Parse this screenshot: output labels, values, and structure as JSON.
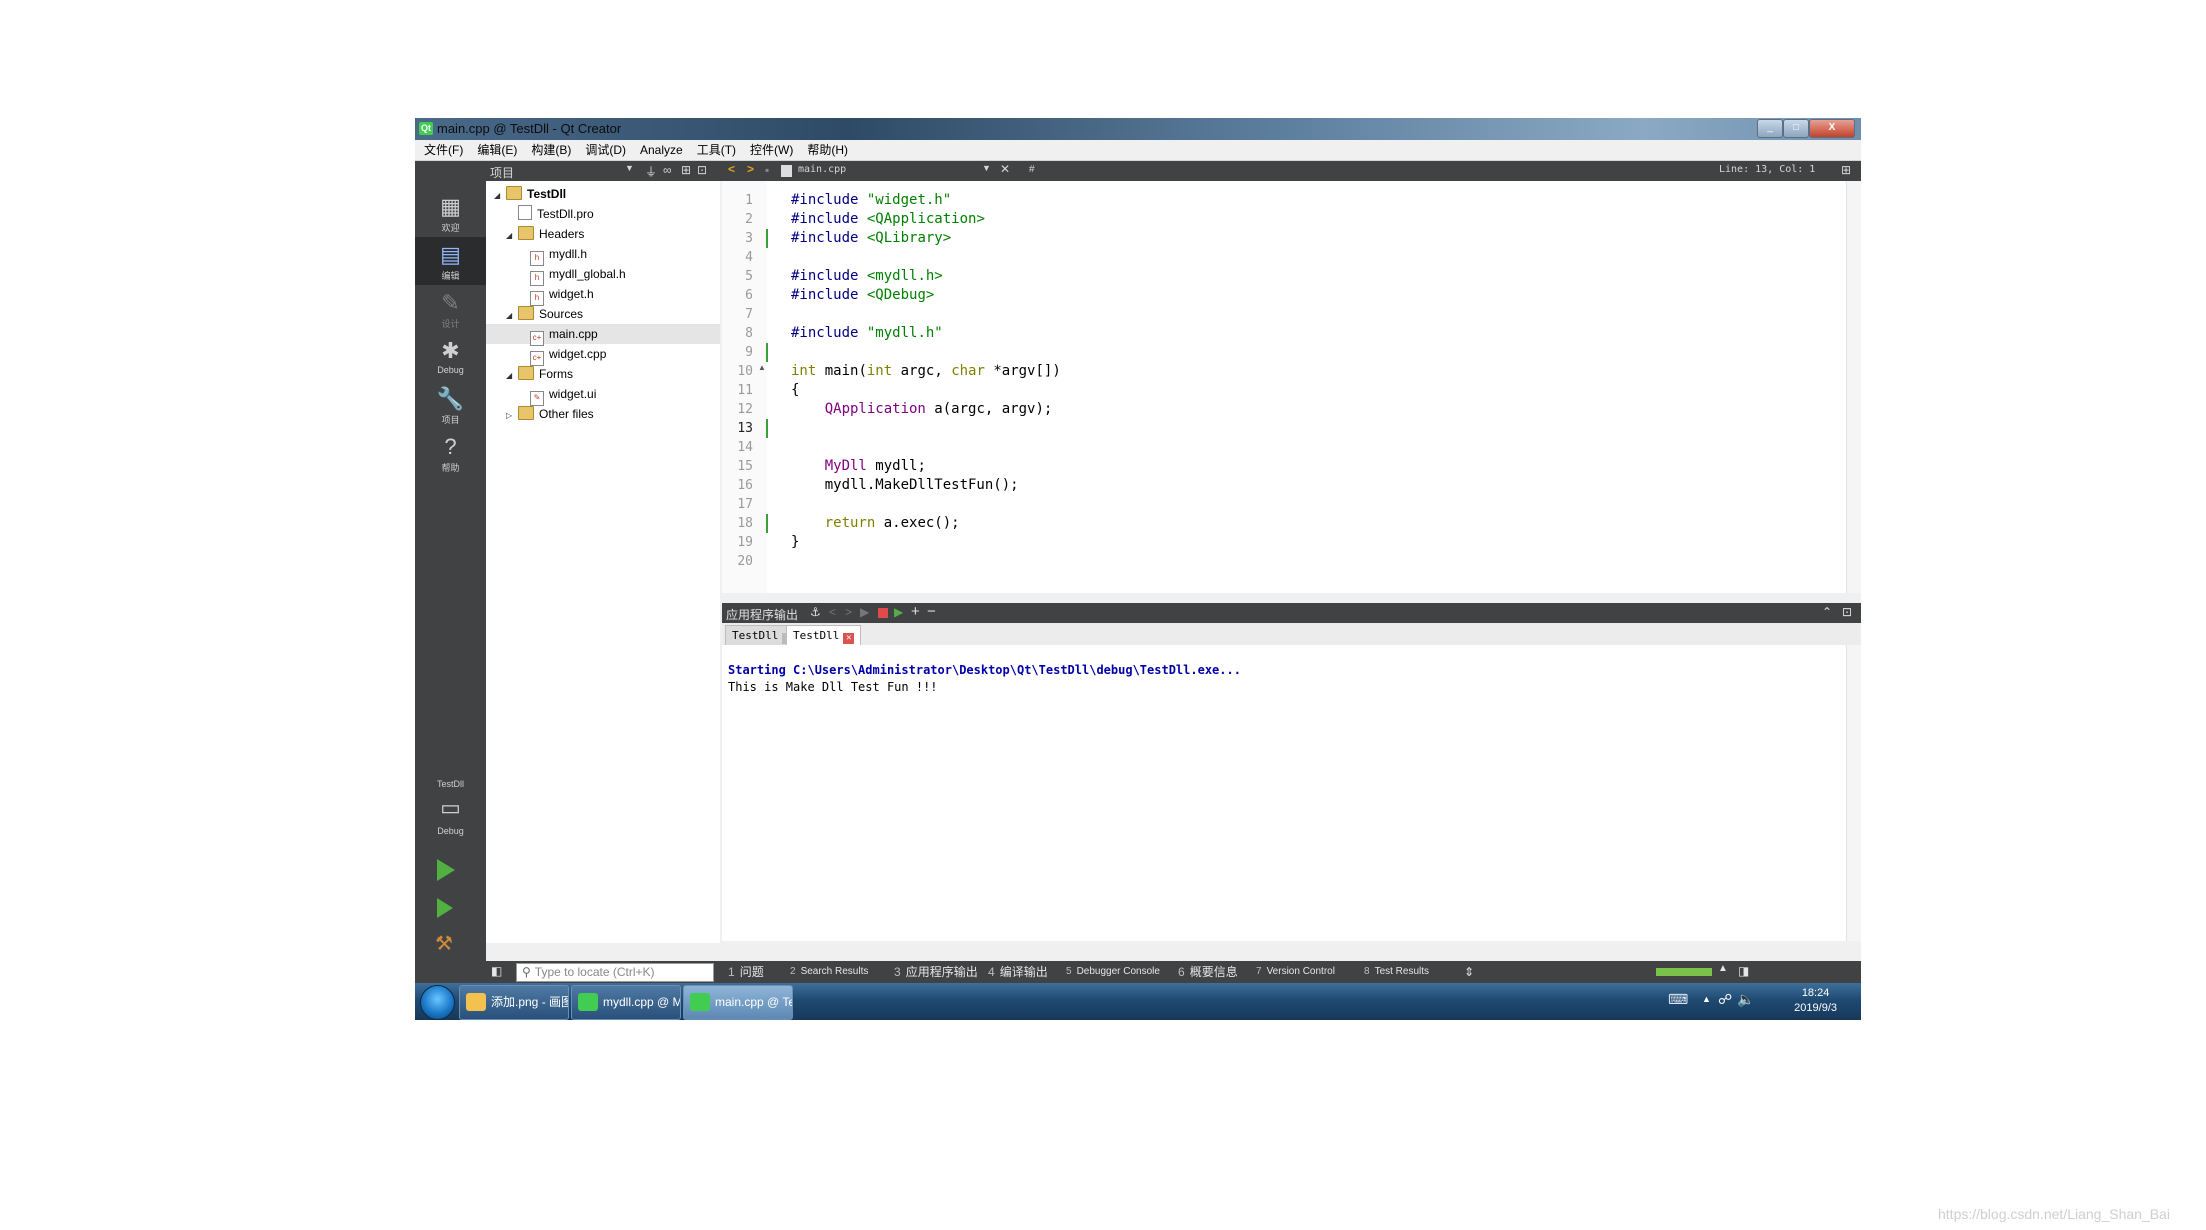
{
  "window": {
    "title": "main.cpp @ TestDll - Qt Creator",
    "min": "_",
    "max": "□",
    "close": "X"
  },
  "menu": [
    "文件(F)",
    "编辑(E)",
    "构建(B)",
    "调试(D)",
    "Analyze",
    "工具(T)",
    "控件(W)",
    "帮助(H)"
  ],
  "projects": {
    "selector": "项目",
    "tree": [
      {
        "label": "TestDll",
        "kind": "project",
        "depth": 0,
        "expanded": true
      },
      {
        "label": "TestDll.pro",
        "kind": "pro",
        "depth": 1
      },
      {
        "label": "Headers",
        "kind": "folder",
        "depth": 1,
        "expanded": true
      },
      {
        "label": "mydll.h",
        "kind": "h",
        "depth": 2
      },
      {
        "label": "mydll_global.h",
        "kind": "h",
        "depth": 2
      },
      {
        "label": "widget.h",
        "kind": "h",
        "depth": 2
      },
      {
        "label": "Sources",
        "kind": "folder",
        "depth": 1,
        "expanded": true
      },
      {
        "label": "main.cpp",
        "kind": "cpp",
        "depth": 2,
        "selected": true
      },
      {
        "label": "widget.cpp",
        "kind": "cpp",
        "depth": 2
      },
      {
        "label": "Forms",
        "kind": "folder",
        "depth": 1,
        "expanded": true
      },
      {
        "label": "widget.ui",
        "kind": "ui",
        "depth": 2
      },
      {
        "label": "Other files",
        "kind": "folder",
        "depth": 1,
        "expanded": false
      }
    ]
  },
  "modes": [
    {
      "label": "欢迎",
      "icon": "grid-icon",
      "glyph": "▦"
    },
    {
      "label": "编辑",
      "icon": "edit-icon",
      "glyph": "▤",
      "active": true
    },
    {
      "label": "设计",
      "icon": "design-icon",
      "glyph": "✎",
      "dim": true
    },
    {
      "label": "Debug",
      "icon": "bug-icon",
      "glyph": "✱"
    },
    {
      "label": "项目",
      "icon": "wrench-icon",
      "glyph": "🔧"
    },
    {
      "label": "帮助",
      "icon": "help-icon",
      "glyph": "?"
    }
  ],
  "kit": {
    "project": "TestDll",
    "config": "Debug"
  },
  "editor": {
    "filename": "main.cpp",
    "hash": "#",
    "position": "Line: 13, Col: 1",
    "current_line": 13,
    "lines": [
      "#include \"widget.h\"",
      "#include <QApplication>",
      "#include <QLibrary>",
      "",
      "#include <mydll.h>",
      "#include <QDebug>",
      "",
      "#include \"mydll.h\"",
      "",
      "int main(int argc, char *argv[])",
      "{",
      "    QApplication a(argc, argv);",
      "",
      "",
      "    MyDll mydll;",
      "    mydll.MakeDllTestFun();",
      "",
      "    return a.exec();",
      "}",
      ""
    ]
  },
  "output": {
    "panel_title": "应用程序输出",
    "tabs": [
      "TestDll",
      "TestDll"
    ],
    "lines": [
      "Starting C:\\Users\\Administrator\\Desktop\\Qt\\TestDll\\debug\\TestDll.exe...",
      "This is Make Dll Test Fun !!!"
    ]
  },
  "statusbar": {
    "locate_placeholder": "Type to locate (Ctrl+K)",
    "panes": [
      {
        "n": "1",
        "label": "问题"
      },
      {
        "n": "2",
        "label": "Search Results"
      },
      {
        "n": "3",
        "label": "应用程序输出"
      },
      {
        "n": "4",
        "label": "编译输出"
      },
      {
        "n": "5",
        "label": "Debugger Console"
      },
      {
        "n": "6",
        "label": "概要信息"
      },
      {
        "n": "7",
        "label": "Version Control"
      },
      {
        "n": "8",
        "label": "Test Results"
      }
    ]
  },
  "taskbar": {
    "items": [
      {
        "label": "添加.png - 画图",
        "color": "#f2c14e"
      },
      {
        "label": "mydll.cpp @ My...",
        "color": "#41cd52"
      },
      {
        "label": "main.cpp @ Tes...",
        "color": "#41cd52",
        "active": true
      }
    ],
    "time": "18:24",
    "date": "2019/9/3"
  },
  "watermark": "https://blog.csdn.net/Liang_Shan_Bai",
  "colors": {
    "ide_dark": "#404244",
    "keyword": "#808000",
    "string": "#008000",
    "type": "#800080",
    "macro": "#000080"
  }
}
